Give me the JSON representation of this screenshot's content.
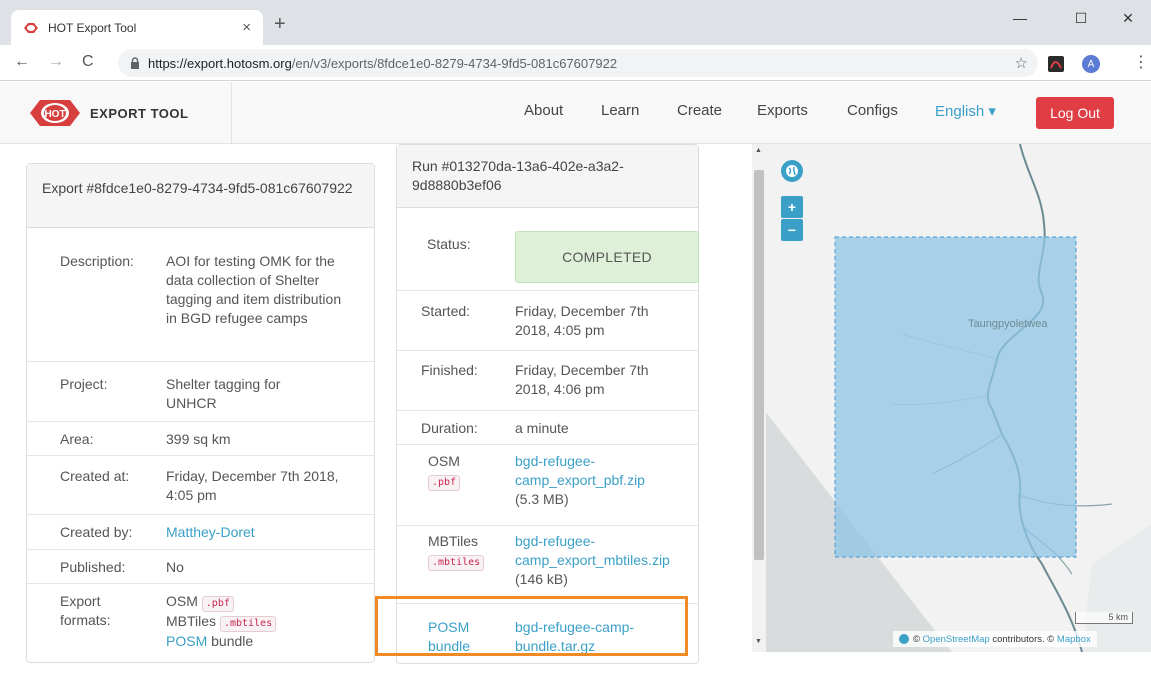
{
  "browser": {
    "tab_title": "HOT Export Tool",
    "tab_close": "×",
    "new_tab": "+",
    "url_host": "https://export.hotosm.org",
    "url_path": "/en/v3/exports/8fdce1e0-8279-4734-9fd5-081c67607922",
    "avatar_letter": "A",
    "win_minimize": "—",
    "win_maximize": "☐",
    "win_close": "✕"
  },
  "header": {
    "brand": "EXPORT TOOL",
    "logo_text": "HOT",
    "nav": [
      "About",
      "Learn",
      "Create",
      "Exports",
      "Configs"
    ],
    "language": "English ▾",
    "logout": "Log Out"
  },
  "export": {
    "heading": "Export #8fdce1e0-8279-4734-9fd5-081c67607922",
    "description_label": "Description:",
    "description": "AOI for testing OMK for the data collection of Shelter tagging and item distribution in BGD refugee camps",
    "project_label": "Project:",
    "project": "Shelter tagging for UNHCR",
    "area_label": "Area:",
    "area": "399 sq km",
    "created_at_label": "Created at:",
    "created_at": "Friday, December 7th 2018, 4:05 pm",
    "created_by_label": "Created by:",
    "created_by": "Matthey-Doret",
    "published_label": "Published:",
    "published": "No",
    "formats_label": "Export formats:",
    "formats": [
      {
        "name": "OSM",
        "code": ".pbf"
      },
      {
        "name": "MBTiles",
        "code": ".mbtiles"
      },
      {
        "name": "POSM",
        "suffix": "bundle"
      }
    ]
  },
  "run": {
    "heading": "Run #013270da-13a6-402e-a3a2-9d8880b3ef06",
    "status_label": "Status:",
    "status": "COMPLETED",
    "started_label": "Started:",
    "started": "Friday, December 7th 2018, 4:05 pm",
    "finished_label": "Finished:",
    "finished": "Friday, December 7th 2018, 4:06 pm",
    "duration_label": "Duration:",
    "duration": "a minute",
    "files": [
      {
        "format": "OSM",
        "code": ".pbf",
        "file": "bgd-refugee-camp_export_pbf.zip",
        "size": "(5.3 MB)"
      },
      {
        "format": "MBTiles",
        "code": ".mbtiles",
        "file": "bgd-refugee-camp_export_mbtiles.zip",
        "size": "(146 kB)"
      },
      {
        "format": "POSM bundle",
        "file": "bgd-refugee-camp-bundle.tar.gz"
      }
    ]
  },
  "map": {
    "place_label": "Taungpyoletwea",
    "scale": "5 km",
    "attribution_prefix": "©",
    "attribution_osm": "OpenStreetMap",
    "attribution_mid": "contributors. ©",
    "attribution_mapbox": "Mapbox",
    "zoom_in": "+",
    "zoom_out": "−",
    "colors": {
      "aoi_fill": "#8fc6e6",
      "aoi_border": "#5aa6d6",
      "river": "#6d8a94"
    }
  }
}
